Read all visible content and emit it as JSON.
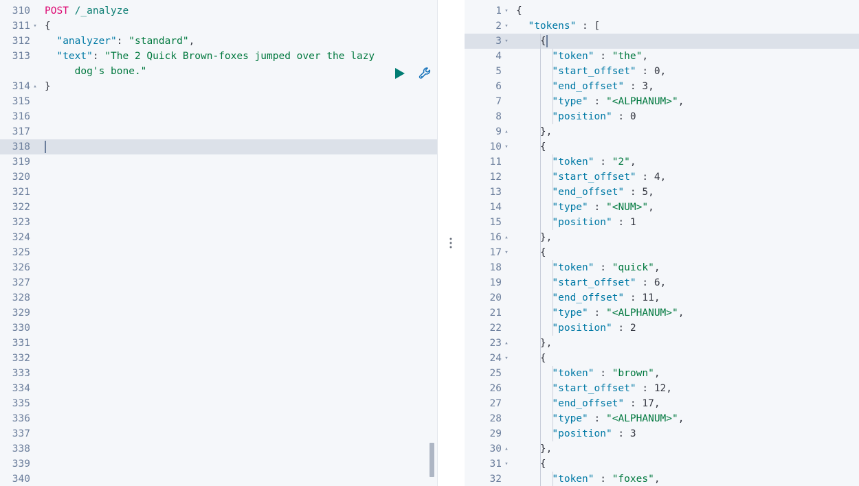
{
  "app": {
    "name": "kibana-dev-tools-console",
    "colors": {
      "editor_bg": "#F5F7FA",
      "active_line_bg": "#DCE1E9",
      "gutter_text": "#6A7D9B",
      "method": "#DD0A73",
      "url": "#0A7D72",
      "key": "#0079A5",
      "string": "#00783E",
      "number": "#343741",
      "play_icon": "#017D73",
      "wrench_icon": "#0079A5",
      "scrollbar_thumb": "#AEB6C4"
    }
  },
  "request_editor": {
    "name": "request-editor",
    "first_line_number": 310,
    "active_line_number": 318,
    "lines": [
      {
        "n": 310,
        "fold": "",
        "segments": [
          {
            "t": "POST ",
            "c": "tok-method"
          },
          {
            "t": "/_analyze",
            "c": "tok-url"
          }
        ]
      },
      {
        "n": 311,
        "fold": "▾",
        "segments": [
          {
            "t": "{",
            "c": "tok-brace"
          }
        ]
      },
      {
        "n": 312,
        "fold": "",
        "segments": [
          {
            "t": "  ",
            "c": "tok-punc"
          },
          {
            "t": "\"analyzer\"",
            "c": "tok-key"
          },
          {
            "t": ": ",
            "c": "tok-punc"
          },
          {
            "t": "\"standard\"",
            "c": "tok-str"
          },
          {
            "t": ",",
            "c": "tok-punc"
          }
        ]
      },
      {
        "n": 313,
        "fold": "",
        "segments": [
          {
            "t": "  ",
            "c": "tok-punc"
          },
          {
            "t": "\"text\"",
            "c": "tok-key"
          },
          {
            "t": ": ",
            "c": "tok-punc"
          },
          {
            "t": "\"The 2 Quick Brown-foxes jumped over the lazy",
            "c": "tok-str"
          }
        ]
      },
      {
        "n": "",
        "fold": "",
        "segments": [
          {
            "t": "     dog's bone.\"",
            "c": "tok-str"
          }
        ]
      },
      {
        "n": 314,
        "fold": "▴",
        "segments": [
          {
            "t": "}",
            "c": "tok-brace"
          }
        ]
      },
      {
        "n": 315,
        "fold": "",
        "segments": []
      },
      {
        "n": 316,
        "fold": "",
        "segments": []
      },
      {
        "n": 317,
        "fold": "",
        "segments": []
      },
      {
        "n": 318,
        "fold": "",
        "segments": [],
        "active": true,
        "caret": true
      },
      {
        "n": 319,
        "fold": "",
        "segments": []
      },
      {
        "n": 320,
        "fold": "",
        "segments": []
      },
      {
        "n": 321,
        "fold": "",
        "segments": []
      },
      {
        "n": 322,
        "fold": "",
        "segments": []
      },
      {
        "n": 323,
        "fold": "",
        "segments": []
      },
      {
        "n": 324,
        "fold": "",
        "segments": []
      },
      {
        "n": 325,
        "fold": "",
        "segments": []
      },
      {
        "n": 326,
        "fold": "",
        "segments": []
      },
      {
        "n": 327,
        "fold": "",
        "segments": []
      },
      {
        "n": 328,
        "fold": "",
        "segments": []
      },
      {
        "n": 329,
        "fold": "",
        "segments": []
      },
      {
        "n": 330,
        "fold": "",
        "segments": []
      },
      {
        "n": 331,
        "fold": "",
        "segments": []
      },
      {
        "n": 332,
        "fold": "",
        "segments": []
      },
      {
        "n": 333,
        "fold": "",
        "segments": []
      },
      {
        "n": 334,
        "fold": "",
        "segments": []
      },
      {
        "n": 335,
        "fold": "",
        "segments": []
      },
      {
        "n": 336,
        "fold": "",
        "segments": []
      },
      {
        "n": 337,
        "fold": "",
        "segments": []
      },
      {
        "n": 338,
        "fold": "",
        "segments": []
      },
      {
        "n": 339,
        "fold": "",
        "segments": []
      },
      {
        "n": 340,
        "fold": "",
        "segments": []
      }
    ],
    "actions": {
      "play_label": "Click to send request",
      "wrench_label": "Open documentation / settings"
    }
  },
  "response_editor": {
    "name": "response-editor",
    "active_line_number": 3,
    "lines": [
      {
        "n": 1,
        "fold": "▾",
        "indent": 0,
        "segments": [
          {
            "t": "{",
            "c": "tok-brace"
          }
        ]
      },
      {
        "n": 2,
        "fold": "▾",
        "indent": 0,
        "segments": [
          {
            "t": "  ",
            "c": "tok-punc"
          },
          {
            "t": "\"tokens\"",
            "c": "tok-key"
          },
          {
            "t": " : [",
            "c": "tok-punc"
          }
        ]
      },
      {
        "n": 3,
        "fold": "▾",
        "indent": 1,
        "active": true,
        "caret": true,
        "segments": [
          {
            "t": "    {",
            "c": "tok-brace"
          }
        ]
      },
      {
        "n": 4,
        "fold": "",
        "indent": 2,
        "segments": [
          {
            "t": "      ",
            "c": "tok-punc"
          },
          {
            "t": "\"token\"",
            "c": "tok-key"
          },
          {
            "t": " : ",
            "c": "tok-punc"
          },
          {
            "t": "\"the\"",
            "c": "tok-str"
          },
          {
            "t": ",",
            "c": "tok-punc"
          }
        ]
      },
      {
        "n": 5,
        "fold": "",
        "indent": 2,
        "segments": [
          {
            "t": "      ",
            "c": "tok-punc"
          },
          {
            "t": "\"start_offset\"",
            "c": "tok-key"
          },
          {
            "t": " : ",
            "c": "tok-punc"
          },
          {
            "t": "0",
            "c": "tok-num"
          },
          {
            "t": ",",
            "c": "tok-punc"
          }
        ]
      },
      {
        "n": 6,
        "fold": "",
        "indent": 2,
        "segments": [
          {
            "t": "      ",
            "c": "tok-punc"
          },
          {
            "t": "\"end_offset\"",
            "c": "tok-key"
          },
          {
            "t": " : ",
            "c": "tok-punc"
          },
          {
            "t": "3",
            "c": "tok-num"
          },
          {
            "t": ",",
            "c": "tok-punc"
          }
        ]
      },
      {
        "n": 7,
        "fold": "",
        "indent": 2,
        "segments": [
          {
            "t": "      ",
            "c": "tok-punc"
          },
          {
            "t": "\"type\"",
            "c": "tok-key"
          },
          {
            "t": " : ",
            "c": "tok-punc"
          },
          {
            "t": "\"<ALPHANUM>\"",
            "c": "tok-str"
          },
          {
            "t": ",",
            "c": "tok-punc"
          }
        ]
      },
      {
        "n": 8,
        "fold": "",
        "indent": 2,
        "segments": [
          {
            "t": "      ",
            "c": "tok-punc"
          },
          {
            "t": "\"position\"",
            "c": "tok-key"
          },
          {
            "t": " : ",
            "c": "tok-punc"
          },
          {
            "t": "0",
            "c": "tok-num"
          }
        ]
      },
      {
        "n": 9,
        "fold": "▴",
        "indent": 1,
        "segments": [
          {
            "t": "    },",
            "c": "tok-brace"
          }
        ]
      },
      {
        "n": 10,
        "fold": "▾",
        "indent": 1,
        "segments": [
          {
            "t": "    {",
            "c": "tok-brace"
          }
        ]
      },
      {
        "n": 11,
        "fold": "",
        "indent": 2,
        "segments": [
          {
            "t": "      ",
            "c": "tok-punc"
          },
          {
            "t": "\"token\"",
            "c": "tok-key"
          },
          {
            "t": " : ",
            "c": "tok-punc"
          },
          {
            "t": "\"2\"",
            "c": "tok-str"
          },
          {
            "t": ",",
            "c": "tok-punc"
          }
        ]
      },
      {
        "n": 12,
        "fold": "",
        "indent": 2,
        "segments": [
          {
            "t": "      ",
            "c": "tok-punc"
          },
          {
            "t": "\"start_offset\"",
            "c": "tok-key"
          },
          {
            "t": " : ",
            "c": "tok-punc"
          },
          {
            "t": "4",
            "c": "tok-num"
          },
          {
            "t": ",",
            "c": "tok-punc"
          }
        ]
      },
      {
        "n": 13,
        "fold": "",
        "indent": 2,
        "segments": [
          {
            "t": "      ",
            "c": "tok-punc"
          },
          {
            "t": "\"end_offset\"",
            "c": "tok-key"
          },
          {
            "t": " : ",
            "c": "tok-punc"
          },
          {
            "t": "5",
            "c": "tok-num"
          },
          {
            "t": ",",
            "c": "tok-punc"
          }
        ]
      },
      {
        "n": 14,
        "fold": "",
        "indent": 2,
        "segments": [
          {
            "t": "      ",
            "c": "tok-punc"
          },
          {
            "t": "\"type\"",
            "c": "tok-key"
          },
          {
            "t": " : ",
            "c": "tok-punc"
          },
          {
            "t": "\"<NUM>\"",
            "c": "tok-str"
          },
          {
            "t": ",",
            "c": "tok-punc"
          }
        ]
      },
      {
        "n": 15,
        "fold": "",
        "indent": 2,
        "segments": [
          {
            "t": "      ",
            "c": "tok-punc"
          },
          {
            "t": "\"position\"",
            "c": "tok-key"
          },
          {
            "t": " : ",
            "c": "tok-punc"
          },
          {
            "t": "1",
            "c": "tok-num"
          }
        ]
      },
      {
        "n": 16,
        "fold": "▴",
        "indent": 1,
        "segments": [
          {
            "t": "    },",
            "c": "tok-brace"
          }
        ]
      },
      {
        "n": 17,
        "fold": "▾",
        "indent": 1,
        "segments": [
          {
            "t": "    {",
            "c": "tok-brace"
          }
        ]
      },
      {
        "n": 18,
        "fold": "",
        "indent": 2,
        "segments": [
          {
            "t": "      ",
            "c": "tok-punc"
          },
          {
            "t": "\"token\"",
            "c": "tok-key"
          },
          {
            "t": " : ",
            "c": "tok-punc"
          },
          {
            "t": "\"quick\"",
            "c": "tok-str"
          },
          {
            "t": ",",
            "c": "tok-punc"
          }
        ]
      },
      {
        "n": 19,
        "fold": "",
        "indent": 2,
        "segments": [
          {
            "t": "      ",
            "c": "tok-punc"
          },
          {
            "t": "\"start_offset\"",
            "c": "tok-key"
          },
          {
            "t": " : ",
            "c": "tok-punc"
          },
          {
            "t": "6",
            "c": "tok-num"
          },
          {
            "t": ",",
            "c": "tok-punc"
          }
        ]
      },
      {
        "n": 20,
        "fold": "",
        "indent": 2,
        "segments": [
          {
            "t": "      ",
            "c": "tok-punc"
          },
          {
            "t": "\"end_offset\"",
            "c": "tok-key"
          },
          {
            "t": " : ",
            "c": "tok-punc"
          },
          {
            "t": "11",
            "c": "tok-num"
          },
          {
            "t": ",",
            "c": "tok-punc"
          }
        ]
      },
      {
        "n": 21,
        "fold": "",
        "indent": 2,
        "segments": [
          {
            "t": "      ",
            "c": "tok-punc"
          },
          {
            "t": "\"type\"",
            "c": "tok-key"
          },
          {
            "t": " : ",
            "c": "tok-punc"
          },
          {
            "t": "\"<ALPHANUM>\"",
            "c": "tok-str"
          },
          {
            "t": ",",
            "c": "tok-punc"
          }
        ]
      },
      {
        "n": 22,
        "fold": "",
        "indent": 2,
        "segments": [
          {
            "t": "      ",
            "c": "tok-punc"
          },
          {
            "t": "\"position\"",
            "c": "tok-key"
          },
          {
            "t": " : ",
            "c": "tok-punc"
          },
          {
            "t": "2",
            "c": "tok-num"
          }
        ]
      },
      {
        "n": 23,
        "fold": "▴",
        "indent": 1,
        "segments": [
          {
            "t": "    },",
            "c": "tok-brace"
          }
        ]
      },
      {
        "n": 24,
        "fold": "▾",
        "indent": 1,
        "segments": [
          {
            "t": "    {",
            "c": "tok-brace"
          }
        ]
      },
      {
        "n": 25,
        "fold": "",
        "indent": 2,
        "segments": [
          {
            "t": "      ",
            "c": "tok-punc"
          },
          {
            "t": "\"token\"",
            "c": "tok-key"
          },
          {
            "t": " : ",
            "c": "tok-punc"
          },
          {
            "t": "\"brown\"",
            "c": "tok-str"
          },
          {
            "t": ",",
            "c": "tok-punc"
          }
        ]
      },
      {
        "n": 26,
        "fold": "",
        "indent": 2,
        "segments": [
          {
            "t": "      ",
            "c": "tok-punc"
          },
          {
            "t": "\"start_offset\"",
            "c": "tok-key"
          },
          {
            "t": " : ",
            "c": "tok-punc"
          },
          {
            "t": "12",
            "c": "tok-num"
          },
          {
            "t": ",",
            "c": "tok-punc"
          }
        ]
      },
      {
        "n": 27,
        "fold": "",
        "indent": 2,
        "segments": [
          {
            "t": "      ",
            "c": "tok-punc"
          },
          {
            "t": "\"end_offset\"",
            "c": "tok-key"
          },
          {
            "t": " : ",
            "c": "tok-punc"
          },
          {
            "t": "17",
            "c": "tok-num"
          },
          {
            "t": ",",
            "c": "tok-punc"
          }
        ]
      },
      {
        "n": 28,
        "fold": "",
        "indent": 2,
        "segments": [
          {
            "t": "      ",
            "c": "tok-punc"
          },
          {
            "t": "\"type\"",
            "c": "tok-key"
          },
          {
            "t": " : ",
            "c": "tok-punc"
          },
          {
            "t": "\"<ALPHANUM>\"",
            "c": "tok-str"
          },
          {
            "t": ",",
            "c": "tok-punc"
          }
        ]
      },
      {
        "n": 29,
        "fold": "",
        "indent": 2,
        "segments": [
          {
            "t": "      ",
            "c": "tok-punc"
          },
          {
            "t": "\"position\"",
            "c": "tok-key"
          },
          {
            "t": " : ",
            "c": "tok-punc"
          },
          {
            "t": "3",
            "c": "tok-num"
          }
        ]
      },
      {
        "n": 30,
        "fold": "▴",
        "indent": 1,
        "segments": [
          {
            "t": "    },",
            "c": "tok-brace"
          }
        ]
      },
      {
        "n": 31,
        "fold": "▾",
        "indent": 1,
        "segments": [
          {
            "t": "    {",
            "c": "tok-brace"
          }
        ]
      },
      {
        "n": 32,
        "fold": "",
        "indent": 2,
        "segments": [
          {
            "t": "      ",
            "c": "tok-punc"
          },
          {
            "t": "\"token\"",
            "c": "tok-key"
          },
          {
            "t": " : ",
            "c": "tok-punc"
          },
          {
            "t": "\"foxes\"",
            "c": "tok-str"
          },
          {
            "t": ",",
            "c": "tok-punc"
          }
        ]
      }
    ]
  },
  "splitter": {
    "name": "panel-splitter",
    "grip_dots": 3
  }
}
